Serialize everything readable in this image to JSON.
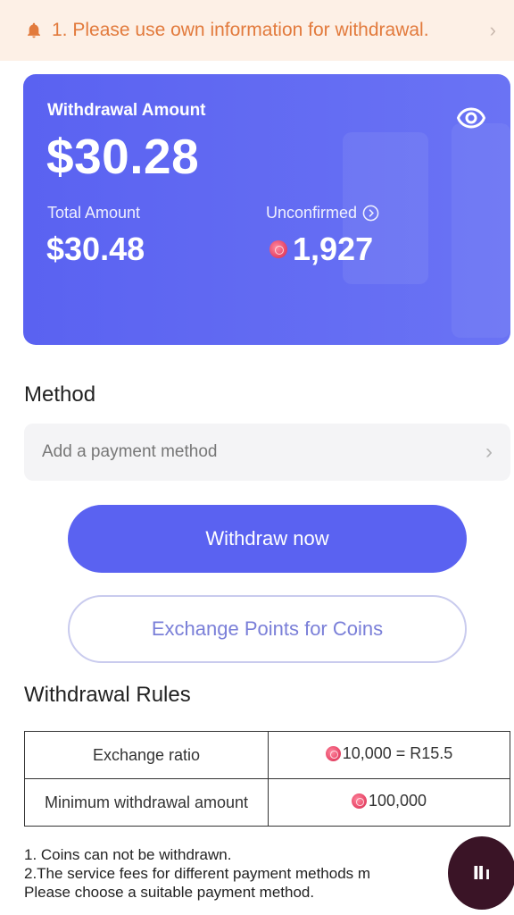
{
  "notice": {
    "text": "1. Please use own information for withdrawal.",
    "icon": "bell-icon",
    "color": "#e27a3c"
  },
  "card": {
    "withdrawal_label": "Withdrawal Amount",
    "withdrawal_amount": "$30.28",
    "total_label": "Total Amount",
    "total_amount": "$30.48",
    "unconfirmed_label": "Unconfirmed",
    "unconfirmed_amount": "1,927",
    "accent": "#5a62f1"
  },
  "method": {
    "title": "Method",
    "placeholder": "Add a payment method"
  },
  "buttons": {
    "withdraw": "Withdraw now",
    "exchange": "Exchange Points for Coins"
  },
  "rules": {
    "title": "Withdrawal Rules",
    "rows": [
      {
        "label": "Exchange ratio",
        "value": "10,000 = R15.5"
      },
      {
        "label": "Minimum withdrawal amount",
        "value": "100,000"
      }
    ],
    "notes": [
      "1. Coins can not be withdrawn.",
      "2.The service fees for different payment methods m",
      "Please choose a suitable payment method."
    ]
  }
}
